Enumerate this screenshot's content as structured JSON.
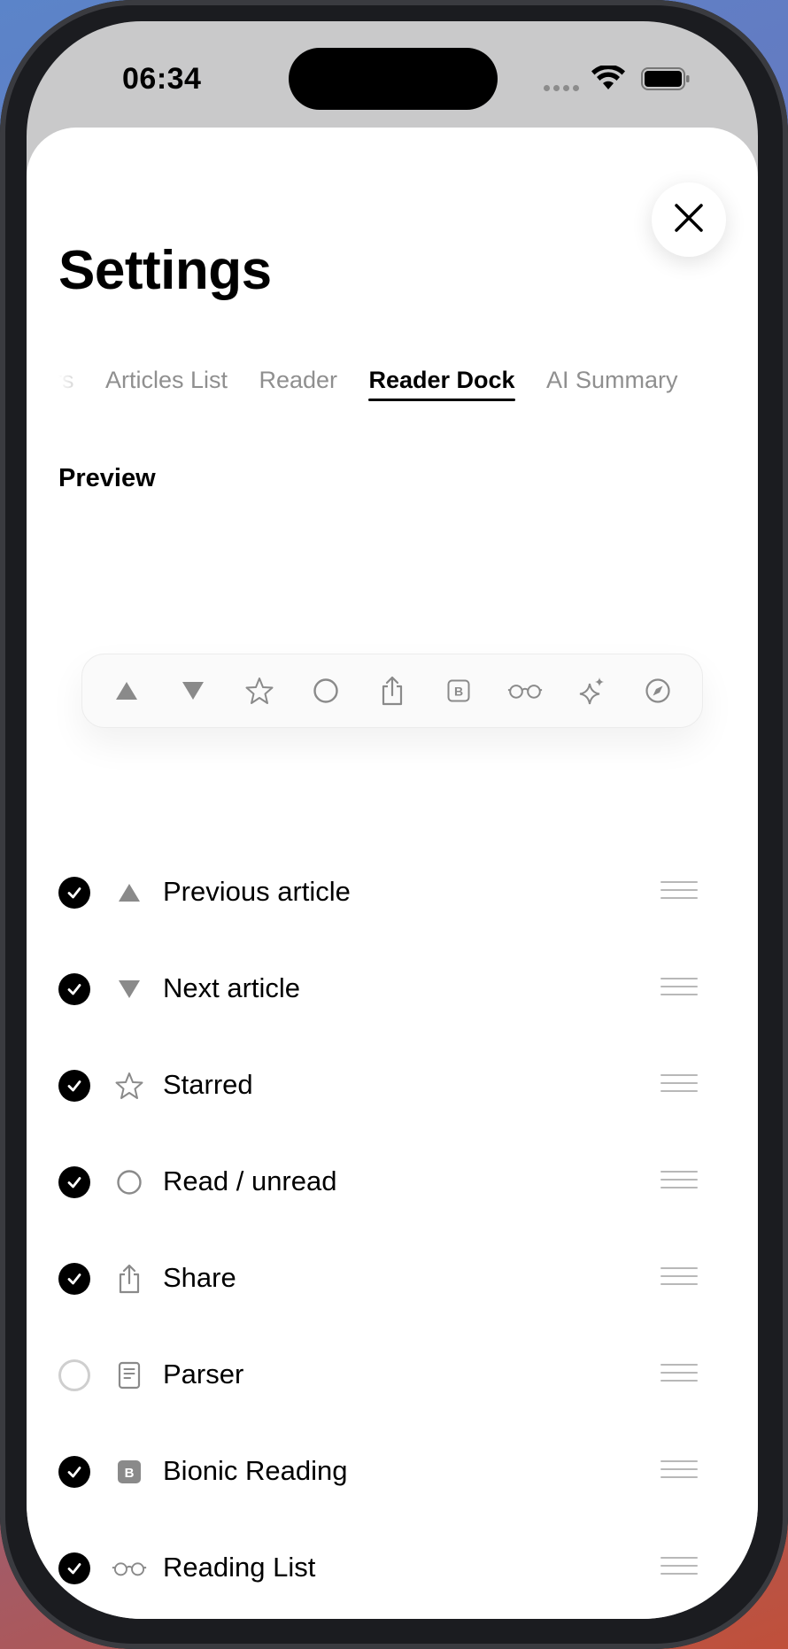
{
  "status_bar": {
    "time": "06:34"
  },
  "header": {
    "title": "Settings",
    "close_icon": "close-icon"
  },
  "tabs": [
    {
      "label": "lers",
      "active": false
    },
    {
      "label": "Articles List",
      "active": false
    },
    {
      "label": "Reader",
      "active": false
    },
    {
      "label": "Reader Dock",
      "active": true
    },
    {
      "label": "AI Summary",
      "active": false
    }
  ],
  "preview": {
    "label": "Preview",
    "dock_icons": [
      "triangle-up-icon",
      "triangle-down-icon",
      "star-icon",
      "circle-icon",
      "share-icon",
      "bionic-icon",
      "glasses-icon",
      "sparkles-icon",
      "compass-icon"
    ]
  },
  "items": [
    {
      "label": "Previous article",
      "enabled": true,
      "icon": "triangle-up-icon"
    },
    {
      "label": "Next article",
      "enabled": true,
      "icon": "triangle-down-icon"
    },
    {
      "label": "Starred",
      "enabled": true,
      "icon": "star-icon"
    },
    {
      "label": "Read / unread",
      "enabled": true,
      "icon": "circle-icon"
    },
    {
      "label": "Share",
      "enabled": true,
      "icon": "share-icon"
    },
    {
      "label": "Parser",
      "enabled": false,
      "icon": "document-icon"
    },
    {
      "label": "Bionic Reading",
      "enabled": true,
      "icon": "bionic-icon"
    },
    {
      "label": "Reading List",
      "enabled": true,
      "icon": "glasses-icon"
    }
  ],
  "colors": {
    "icon_gray": "#8a8a8a",
    "check_on": "#000000",
    "check_off": "#cfcfcf"
  }
}
